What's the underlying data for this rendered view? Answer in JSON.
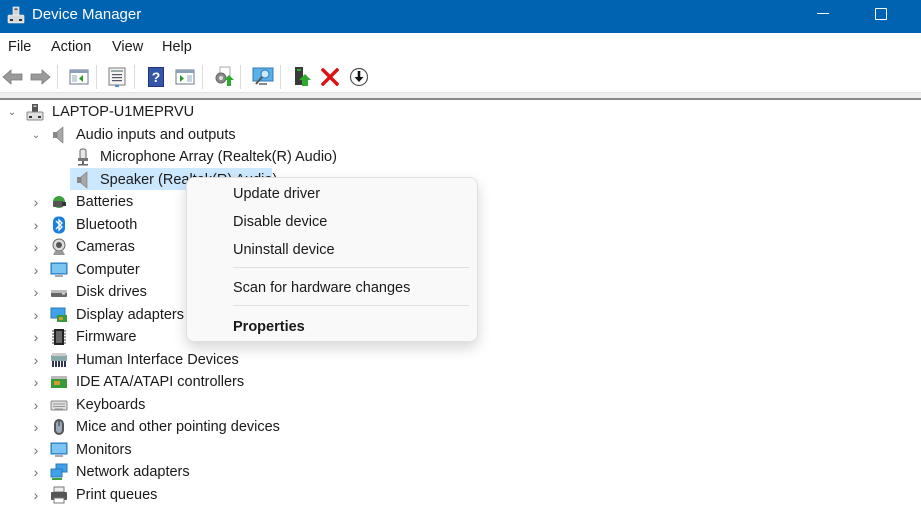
{
  "window": {
    "title": "Device Manager",
    "icon": "device-manager-icon",
    "controls": {
      "minimize": "minimize-icon",
      "maximize": "maximize-icon"
    }
  },
  "menubar": {
    "items": [
      {
        "label": "File"
      },
      {
        "label": "Action"
      },
      {
        "label": "View"
      },
      {
        "label": "Help"
      }
    ]
  },
  "toolbar": {
    "buttons": [
      {
        "name": "back",
        "icon": "arrow-left-icon"
      },
      {
        "name": "forward",
        "icon": "arrow-right-icon"
      },
      {
        "name": "show-hide-console-tree",
        "icon": "console-tree-icon"
      },
      {
        "name": "properties",
        "icon": "properties-sheet-icon"
      },
      {
        "name": "help",
        "icon": "help-icon"
      },
      {
        "name": "show-action-pane",
        "icon": "action-pane-icon"
      },
      {
        "name": "update-driver",
        "icon": "update-driver-icon"
      },
      {
        "name": "scan-hardware",
        "icon": "scan-hardware-icon"
      },
      {
        "name": "add-legacy-hardware",
        "icon": "add-hardware-icon"
      },
      {
        "name": "uninstall-device",
        "icon": "uninstall-x-icon"
      },
      {
        "name": "disable-device",
        "icon": "disable-down-arrow-icon"
      }
    ]
  },
  "tree": {
    "root": {
      "label": "LAPTOP-U1MEPRVU",
      "icon": "computer-tower-icon",
      "expanded": true
    },
    "expanded_category": {
      "label": "Audio inputs and outputs",
      "icon": "speaker-icon",
      "children": [
        {
          "label": "Microphone Array (Realtek(R) Audio)",
          "icon": "microphone-icon"
        },
        {
          "label": "Speaker (Realtek(R) Audio)",
          "icon": "speaker-icon",
          "selected": true
        }
      ]
    },
    "categories": [
      {
        "label": "Batteries",
        "icon": "battery-icon"
      },
      {
        "label": "Bluetooth",
        "icon": "bluetooth-icon"
      },
      {
        "label": "Cameras",
        "icon": "camera-icon"
      },
      {
        "label": "Computer",
        "icon": "monitor-icon"
      },
      {
        "label": "Disk drives",
        "icon": "disk-drive-icon"
      },
      {
        "label": "Display adapters",
        "icon": "display-adapter-icon"
      },
      {
        "label": "Firmware",
        "icon": "chip-icon"
      },
      {
        "label": "Human Interface Devices",
        "icon": "hid-icon"
      },
      {
        "label": "IDE ATA/ATAPI controllers",
        "icon": "ide-controller-icon"
      },
      {
        "label": "Keyboards",
        "icon": "keyboard-icon"
      },
      {
        "label": "Mice and other pointing devices",
        "icon": "mouse-icon"
      },
      {
        "label": "Monitors",
        "icon": "monitor-icon"
      },
      {
        "label": "Network adapters",
        "icon": "network-icon"
      },
      {
        "label": "Print queues",
        "icon": "printer-icon"
      }
    ]
  },
  "context_menu": {
    "items": [
      {
        "label": "Update driver"
      },
      {
        "label": "Disable device"
      },
      {
        "label": "Uninstall device"
      },
      {
        "label": "Scan for hardware changes"
      },
      {
        "label": "Properties",
        "default": true
      }
    ]
  },
  "colors": {
    "titlebar": "#0063b1",
    "selection": "#cce8ff",
    "menu_bg": "#f9f9f9"
  }
}
